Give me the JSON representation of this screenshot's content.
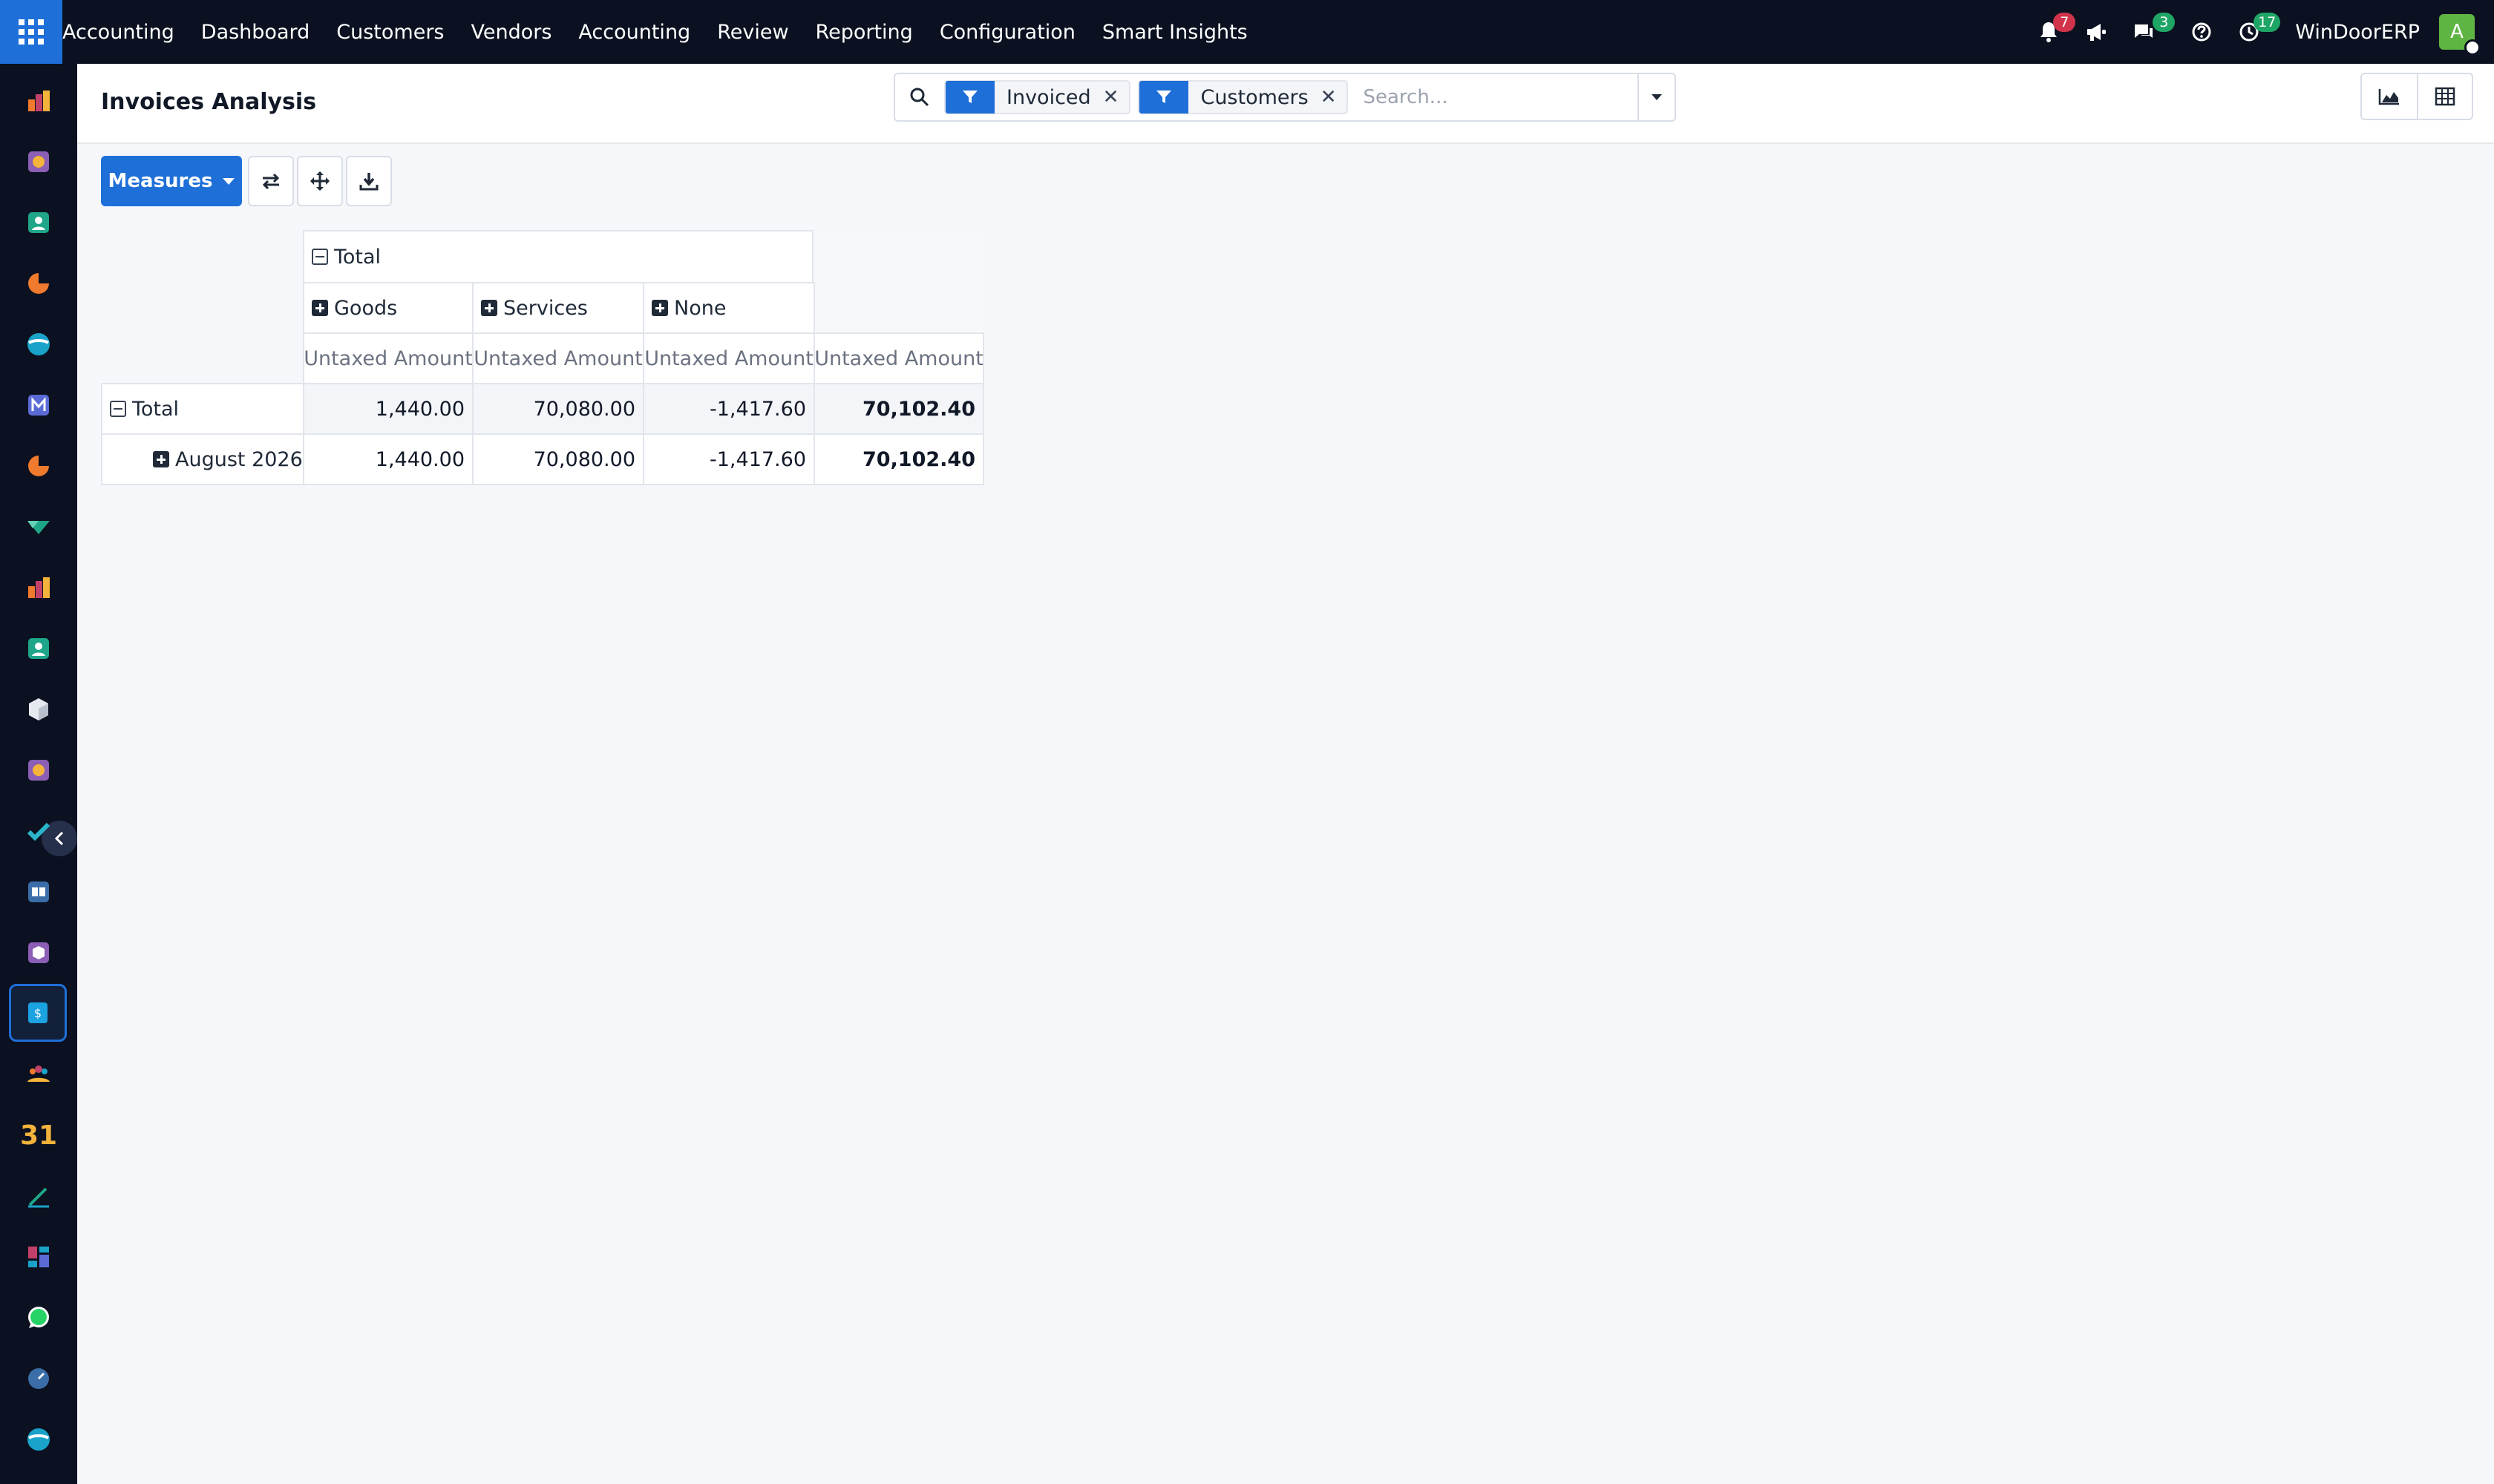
{
  "navbar": {
    "app_name": "Accounting",
    "menu": [
      "Dashboard",
      "Customers",
      "Vendors",
      "Accounting",
      "Review",
      "Reporting",
      "Configuration",
      "Smart Insights"
    ],
    "notifications_badge": "7",
    "messages_badge": "3",
    "activities_badge": "17",
    "company": "WinDoorERP",
    "avatar_initial": "A",
    "badge_colors": {
      "notifications": "#d1334a",
      "messages": "#1fa566",
      "activities": "#1fa566"
    }
  },
  "sidebar": {
    "apps": [
      "invoicing-icon",
      "sales-icon",
      "contacts-icon",
      "crm-icon",
      "discuss-icon",
      "mail-icon",
      "helpdesk-icon",
      "project-icon",
      "reporting-icon",
      "employees-icon",
      "inventory-icon",
      "expenses-icon",
      "todo-icon",
      "knowledge-icon",
      "purchase-icon",
      "accounting-icon",
      "team-icon",
      "calendar-icon",
      "sign-icon",
      "dashboards-icon",
      "whatsapp-icon",
      "timesheet-icon",
      "live-chat-icon"
    ],
    "calendar_text": "31"
  },
  "control_panel": {
    "title": "Invoices Analysis",
    "facets": [
      {
        "label": "Invoiced"
      },
      {
        "label": "Customers"
      }
    ],
    "search_placeholder": "Search..."
  },
  "toolbar": {
    "measures_label": "Measures"
  },
  "pivot": {
    "col_group_header": "Total",
    "col_headers": [
      "Goods",
      "Services",
      "None"
    ],
    "measure_label": "Untaxed Amount",
    "rows": [
      {
        "label": "Total",
        "values": [
          "1,440.00",
          "70,080.00",
          "-1,417.60",
          "70,102.40"
        ]
      },
      {
        "label": "August 2026",
        "values": [
          "1,440.00",
          "70,080.00",
          "-1,417.60",
          "70,102.40"
        ]
      }
    ]
  },
  "colors": {
    "primary": "#1f6fd8",
    "navbar_bg": "#0b1120"
  }
}
